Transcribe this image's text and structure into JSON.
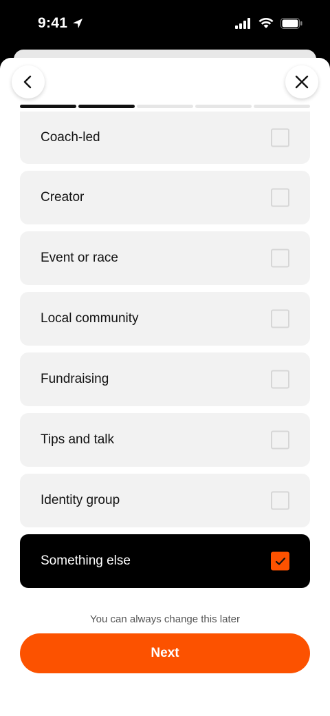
{
  "status_bar": {
    "time": "9:41"
  },
  "nav": {
    "back_icon": "chevron-left-icon",
    "close_icon": "close-icon"
  },
  "progress": {
    "total_steps": 5,
    "completed_steps": 2
  },
  "options": [
    {
      "label": "Coach-led",
      "checked": false
    },
    {
      "label": "Creator",
      "checked": false
    },
    {
      "label": "Event or race",
      "checked": false
    },
    {
      "label": "Local community",
      "checked": false
    },
    {
      "label": "Fundraising",
      "checked": false
    },
    {
      "label": "Tips and talk",
      "checked": false
    },
    {
      "label": "Identity group",
      "checked": false
    },
    {
      "label": "Something else",
      "checked": true
    }
  ],
  "footer": {
    "hint": "You can always change this later",
    "next_label": "Next"
  },
  "colors": {
    "accent": "#fc5200",
    "selected_bg": "#000000",
    "option_bg": "#f2f2f2"
  }
}
